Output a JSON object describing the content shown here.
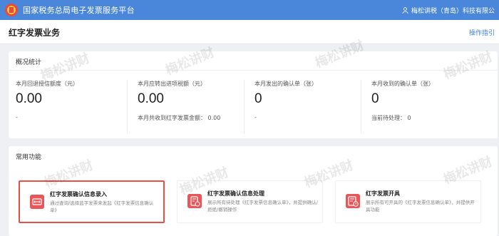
{
  "topbar": {
    "title": "国家税务总局电子发票服务平台",
    "user": "梅松讲税（青岛）科技有限公"
  },
  "page": {
    "title": "红字发票业务",
    "guide_link": "操作指引"
  },
  "stats": {
    "section_title": "概况统计",
    "items": [
      {
        "label": "本月回退授信额度（元）",
        "value": "0.00",
        "sub": "-"
      },
      {
        "label": "本月应转出进项税额（元）",
        "value": "0.00",
        "sub": "本月共收到红字发票金额： 0.00"
      },
      {
        "label": "本月发出的确认单（张）",
        "value": "0",
        "sub": "-"
      },
      {
        "label": "本月收到的确认单（张）",
        "value": "0",
        "sub": "当前待处理： 0"
      }
    ]
  },
  "functions": {
    "section_title": "常用功能",
    "items": [
      {
        "name": "红字发票确认信息录入",
        "desc": "通过查询/选择蓝字发票来发起《红字发票信息确认单》",
        "icon": "exchange-icon"
      },
      {
        "name": "红字发票确认信息处理",
        "desc": "展示所有待处理《红字发票信息确认单》，并提供确认/拒绝/撤销操作",
        "icon": "document-check-icon"
      },
      {
        "name": "红字发票开具",
        "desc": "展示所有可开具的《红字发票信息确认单》，并提供开具功能",
        "icon": "invoice-clock-icon"
      }
    ]
  },
  "watermark": "梅松讲财",
  "colors": {
    "topbar": "#4a86d9",
    "link": "#3f7fe0",
    "icon_red": "#e8565a",
    "highlight_border": "#e65146"
  }
}
